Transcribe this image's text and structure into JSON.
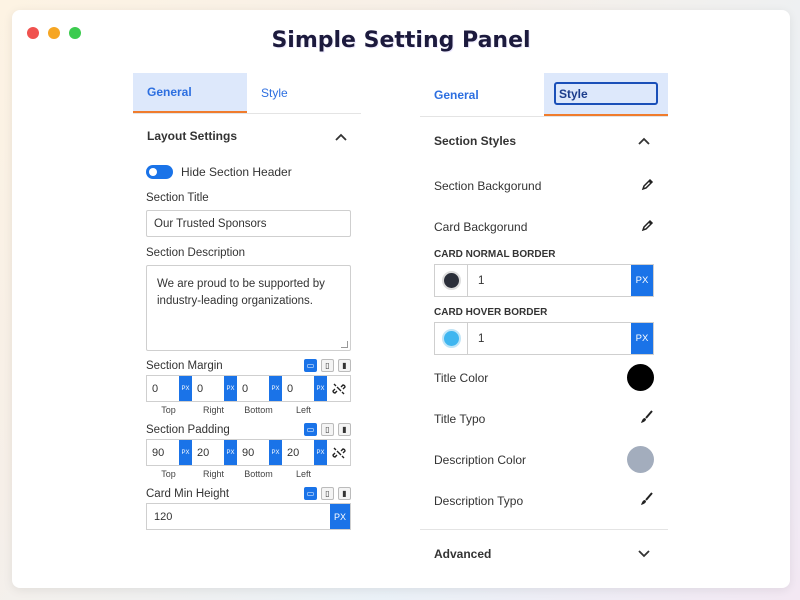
{
  "app": {
    "title": "Simple Setting Panel"
  },
  "left_panel": {
    "tabs": [
      {
        "label": "General"
      },
      {
        "label": "Style"
      }
    ],
    "section_title": "Layout Settings",
    "toggle_label": "Hide Section Header",
    "section_title_label": "Section Title",
    "section_title_value": "Our Trusted Sponsors",
    "section_description_label": "Section Description",
    "section_description_value": "We are proud to be supported by industry-leading organizations.",
    "margin": {
      "label": "Section Margin",
      "values": [
        "0",
        "0",
        "0",
        "0"
      ],
      "unit": "PX",
      "sides": [
        "Top",
        "Right",
        "Bottom",
        "Left"
      ]
    },
    "padding": {
      "label": "Section Padding",
      "values": [
        "90",
        "20",
        "90",
        "20"
      ],
      "unit": "PX",
      "sides": [
        "Top",
        "Right",
        "Bottom",
        "Left"
      ]
    },
    "min_height": {
      "label": "Card Min Height",
      "value": "120",
      "unit": "PX"
    }
  },
  "right_panel": {
    "tabs": [
      {
        "label": "General"
      },
      {
        "label": "Style"
      }
    ],
    "section_title": "Section Styles",
    "rows": {
      "section_background": "Section Backgorund",
      "card_background": "Card Backgorund",
      "title_color": "Title Color",
      "title_typo": "Title Typo",
      "description_color": "Description Color",
      "description_typo": "Description Typo"
    },
    "card_normal_border": {
      "label": "CARD NORMAL BORDER",
      "value": "1",
      "unit": "PX",
      "color": "#2b2f3a"
    },
    "card_hover_border": {
      "label": "CARD HOVER BORDER",
      "value": "1",
      "unit": "PX",
      "color": "#3fb6f0"
    },
    "title_color_value": "#000000",
    "description_color_value": "#a3adbd",
    "advanced_label": "Advanced"
  },
  "colors": {
    "accent": "#1a73e8",
    "tab_active_bg": "#dde8fb",
    "tab_underline": "#f07c2c"
  },
  "icons": {
    "edit": "pencil-icon",
    "brush": "brush-icon",
    "link": "unlink-icon",
    "chevron_up": "chevron-up-icon",
    "chevron_down": "chevron-down-icon"
  }
}
